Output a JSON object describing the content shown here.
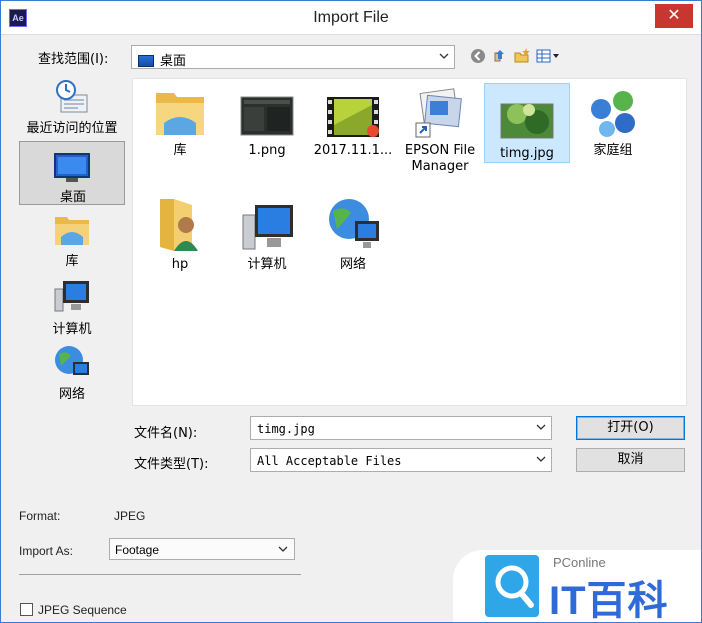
{
  "window": {
    "app_icon_text": "Ae",
    "title": "Import File",
    "close": "✕"
  },
  "lookin": {
    "label": "查找范围(I):",
    "value": "桌面"
  },
  "toolbar": {
    "icons": [
      "back-icon",
      "up-folder-icon",
      "new-folder-icon",
      "view-menu-icon"
    ]
  },
  "places": [
    {
      "label": "最近访问的位置",
      "icon": "recent-places-icon"
    },
    {
      "label": "桌面",
      "icon": "desktop-icon",
      "active": true
    },
    {
      "label": "库",
      "icon": "libraries-icon"
    },
    {
      "label": "计算机",
      "icon": "computer-icon"
    },
    {
      "label": "网络",
      "icon": "network-icon"
    }
  ],
  "files": [
    {
      "label": "库",
      "icon": "libraries-icon"
    },
    {
      "label": "1.png",
      "icon": "image-thumbnail-icon"
    },
    {
      "label": "2017.11.1...",
      "icon": "video-thumbnail-icon"
    },
    {
      "label": "EPSON File Manager",
      "icon": "epson-shortcut-icon"
    },
    {
      "label": "timg.jpg",
      "icon": "image-thumbnail-icon",
      "selected": true
    },
    {
      "label": "家庭组",
      "icon": "homegroup-icon"
    },
    {
      "label": "hp",
      "icon": "user-folder-icon"
    },
    {
      "label": "计算机",
      "icon": "computer-icon"
    },
    {
      "label": "网络",
      "icon": "network-icon"
    }
  ],
  "filename": {
    "label": "文件名(N):",
    "value": "timg.jpg"
  },
  "filetype": {
    "label": "文件类型(T):",
    "value": "All Acceptable Files"
  },
  "buttons": {
    "open": "打开(O)",
    "cancel": "取消"
  },
  "format": {
    "label": "Format:",
    "value": "JPEG"
  },
  "import_as": {
    "label": "Import As:",
    "value": "Footage"
  },
  "sequence": {
    "label": "JPEG Sequence",
    "checked": false
  },
  "watermark": {
    "small": "PConline",
    "big": "IT百科"
  },
  "colors": {
    "accent": "#0078d7",
    "close": "#c7372f",
    "selection": "#cce8ff"
  }
}
